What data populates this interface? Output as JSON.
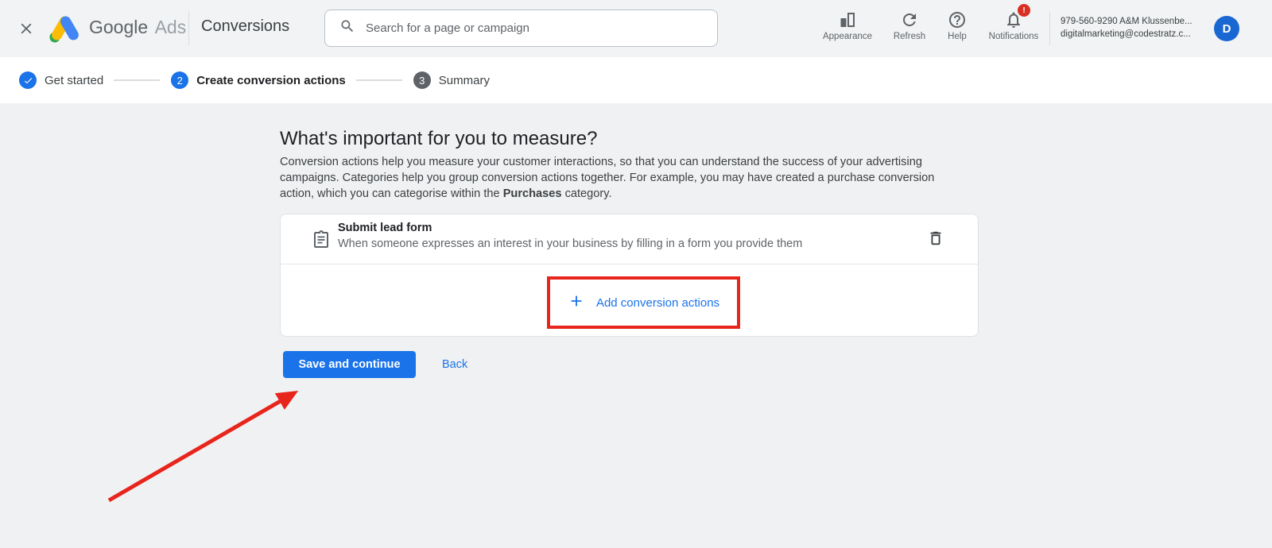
{
  "topbar": {
    "brand_primary": "Google",
    "brand_secondary": "Ads",
    "section_title": "Conversions",
    "search_placeholder": "Search for a page or campaign",
    "actions": [
      {
        "label": "Appearance"
      },
      {
        "label": "Refresh"
      },
      {
        "label": "Help"
      },
      {
        "label": "Notifications"
      }
    ],
    "notification_badge": "!",
    "account": {
      "line1": "979-560-9290 A&M Klussenbe...",
      "line2": "digitalmarketing@codestratz.c...",
      "avatar_initial": "D"
    }
  },
  "stepper": {
    "steps": [
      {
        "label": "Get started",
        "state": "complete"
      },
      {
        "number": "2",
        "label": "Create conversion actions",
        "state": "active"
      },
      {
        "number": "3",
        "label": "Summary",
        "state": "upcoming"
      }
    ]
  },
  "main": {
    "heading": "What's important for you to measure?",
    "description_part1": "Conversion actions help you measure your customer interactions, so that you can understand the success of your advertising campaigns. Categories help you group conversion actions together. For example, you may have created a purchase conversion action, which you can categorise within the ",
    "description_bold": "Purchases",
    "description_part2": " category.",
    "conversion_action": {
      "title": "Submit lead form",
      "description": "When someone expresses an interest in your business by filling in a form you provide them"
    },
    "add_button_label": "Add conversion actions",
    "save_button_label": "Save and continue",
    "back_label": "Back"
  },
  "colors": {
    "accent-blue": "#1a73e8",
    "annotation-red": "#e8251c",
    "badge-red": "#d93025",
    "avatar-blue": "#1967d2",
    "logo-yellow": "#fbbc04",
    "logo-blue": "#4285f4",
    "logo-green": "#34a853",
    "icon-gray": "#5f6368"
  }
}
